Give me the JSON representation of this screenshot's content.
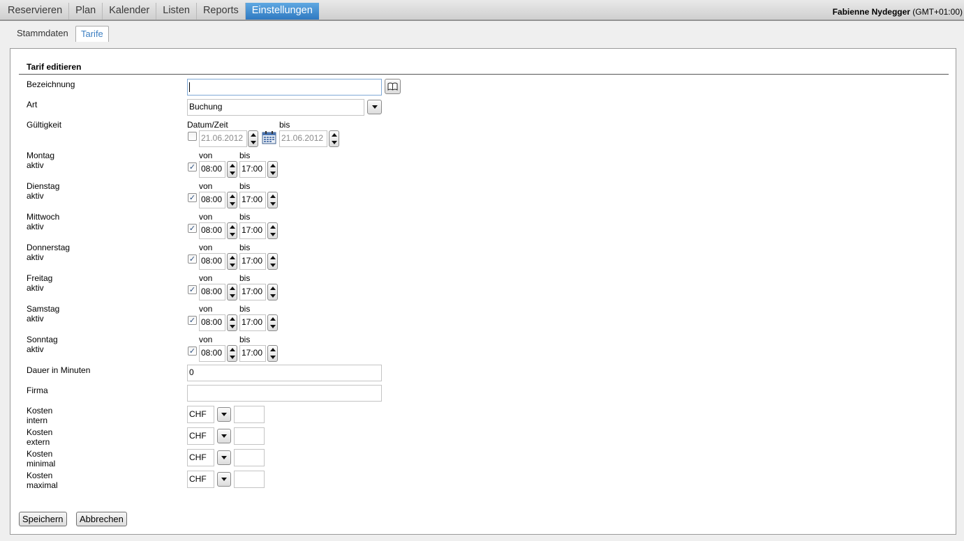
{
  "menu": {
    "items": [
      "Reservieren",
      "Plan",
      "Kalender",
      "Listen",
      "Reports",
      "Einstellungen"
    ],
    "active": "Einstellungen"
  },
  "user": {
    "name": "Fabienne Nydegger",
    "timezone": "(GMT+01:00)"
  },
  "subtabs": {
    "stammdaten": "Stammdaten",
    "tarife": "Tarife"
  },
  "form": {
    "title": "Tarif editieren",
    "bezeichnung": {
      "label": "Bezeichnung",
      "value": ""
    },
    "art": {
      "label": "Art",
      "value": "Buchung"
    },
    "gueltigkeit": {
      "label": "Gültigkeit",
      "from_header": "Datum/Zeit",
      "to_header": "bis",
      "from": "21.06.2012",
      "to": "21.06.2012",
      "checked": false
    },
    "von_label": "von",
    "bis_label": "bis",
    "days": [
      {
        "label": "Montag aktiv",
        "von": "08:00",
        "bis": "17:00",
        "checked": true
      },
      {
        "label": "Dienstag aktiv",
        "von": "08:00",
        "bis": "17:00",
        "checked": true
      },
      {
        "label": "Mittwoch aktiv",
        "von": "08:00",
        "bis": "17:00",
        "checked": true
      },
      {
        "label": "Donnerstag aktiv",
        "von": "08:00",
        "bis": "17:00",
        "checked": true
      },
      {
        "label": "Freitag aktiv",
        "von": "08:00",
        "bis": "17:00",
        "checked": true
      },
      {
        "label": "Samstag aktiv",
        "von": "08:00",
        "bis": "17:00",
        "checked": true
      },
      {
        "label": "Sonntag aktiv",
        "von": "08:00",
        "bis": "17:00",
        "checked": true
      }
    ],
    "dauer": {
      "label": "Dauer in Minuten",
      "value": "0"
    },
    "firma": {
      "label": "Firma",
      "value": ""
    },
    "costs": [
      {
        "label": "Kosten intern",
        "currency": "CHF",
        "value": ""
      },
      {
        "label": "Kosten extern",
        "currency": "CHF",
        "value": ""
      },
      {
        "label": "Kosten minimal",
        "currency": "CHF",
        "value": ""
      },
      {
        "label": "Kosten maximal",
        "currency": "CHF",
        "value": ""
      }
    ]
  },
  "actions": {
    "save": "Speichern",
    "cancel": "Abbrechen"
  },
  "icons": {
    "lookup": "book-icon",
    "calendar": "calendar-icon",
    "dropdown": "chevron-down-icon"
  },
  "colors": {
    "active_tab": "#3c7fc2",
    "active_menu": "#2f79c1"
  }
}
